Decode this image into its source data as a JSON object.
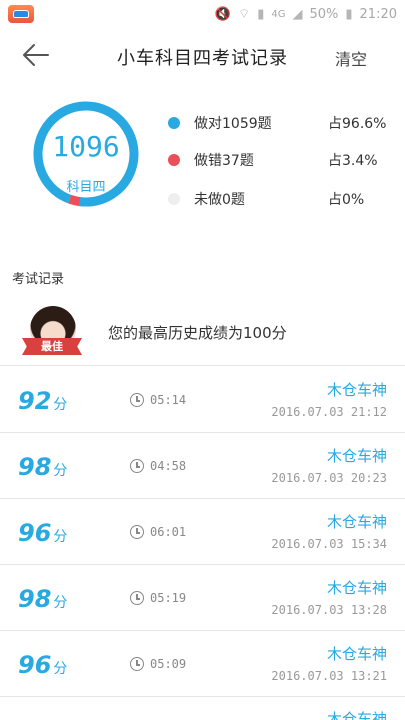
{
  "status_bar": {
    "network": "4G",
    "battery": "50%",
    "time": "21:20"
  },
  "header": {
    "title": "小车科目四考试记录",
    "clear_label": "清空"
  },
  "summary": {
    "total": "1096",
    "subject": "科目四",
    "correct_fraction": 0.966,
    "legend": [
      {
        "text": "做对1059题",
        "pct": "占96.6%",
        "color": "#29a9e1"
      },
      {
        "text": "做错37题",
        "pct": "占3.4%",
        "color": "#e9505a"
      },
      {
        "text": "未做0题",
        "pct": "占0%",
        "color": "#eeeeee"
      }
    ]
  },
  "section_label": "考试记录",
  "best": {
    "ribbon": "最佳",
    "text": "您的最高历史成绩为100分"
  },
  "records": [
    {
      "score": "92",
      "unit": "分",
      "duration": "05:14",
      "name": "木仓车神",
      "date": "2016.07.03  21:12"
    },
    {
      "score": "98",
      "unit": "分",
      "duration": "04:58",
      "name": "木仓车神",
      "date": "2016.07.03  20:23"
    },
    {
      "score": "96",
      "unit": "分",
      "duration": "06:01",
      "name": "木仓车神",
      "date": "2016.07.03  15:34"
    },
    {
      "score": "98",
      "unit": "分",
      "duration": "05:19",
      "name": "木仓车神",
      "date": "2016.07.03  13:28"
    },
    {
      "score": "96",
      "unit": "分",
      "duration": "05:09",
      "name": "木仓车神",
      "date": "2016.07.03  13:21"
    }
  ],
  "partial_next": "木仓车神"
}
